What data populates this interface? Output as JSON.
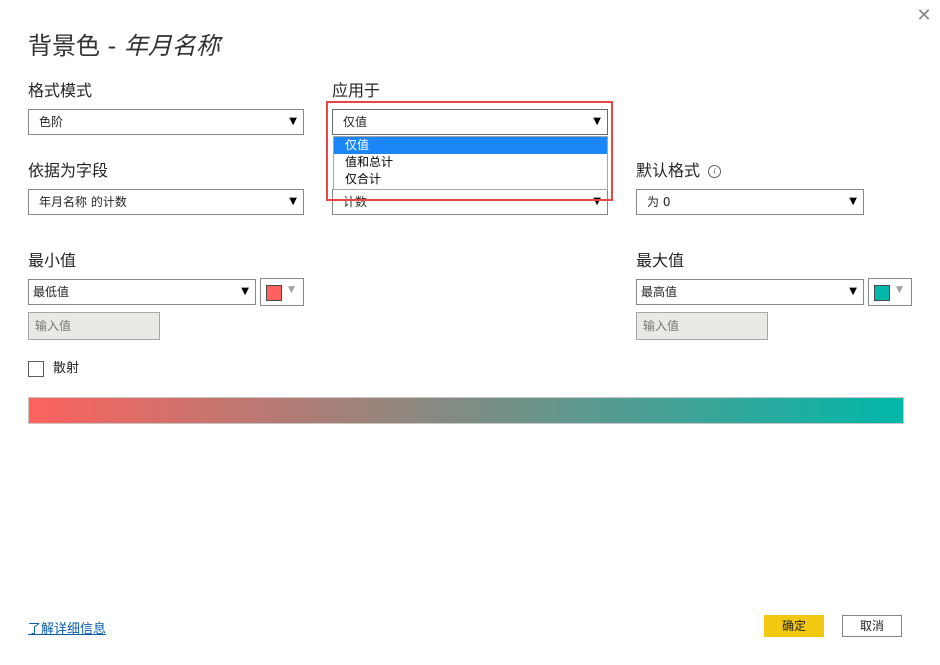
{
  "dialog": {
    "title_prefix": "背景色 - ",
    "title_field": "年月名称",
    "close_icon": "close-icon"
  },
  "format_mode": {
    "label": "格式模式",
    "value": "色阶"
  },
  "apply_to": {
    "label": "应用于",
    "value": "仅值",
    "options": [
      "仅值",
      "值和总计",
      "仅合计"
    ],
    "selected_index": 0,
    "hidden_behind_value": "计数"
  },
  "based_on_field": {
    "label": "依据为字段",
    "value": "年月名称 的计数"
  },
  "default_format": {
    "label": "默认格式",
    "info_icon": "info-icon",
    "value": "为 0"
  },
  "minimum": {
    "label": "最小值",
    "value": "最低值",
    "placeholder": "输入值",
    "color": "#fd625e"
  },
  "maximum": {
    "label": "最大值",
    "value": "最高值",
    "placeholder": "输入值",
    "color": "#01b8aa"
  },
  "diverging": {
    "label": "散射",
    "checked": false
  },
  "gradient": {
    "from": "#fd625e",
    "to": "#01b8aa"
  },
  "footer": {
    "learn_more": "了解详细信息",
    "ok": "确定",
    "cancel": "取消"
  },
  "highlight_color": "#e84747"
}
